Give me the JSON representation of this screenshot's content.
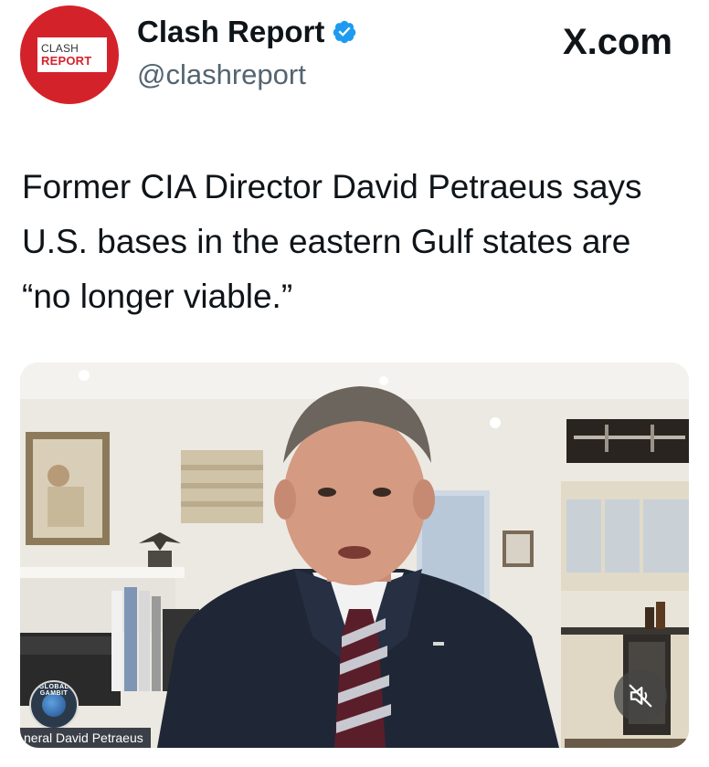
{
  "header": {
    "avatar": {
      "line1": "CLASH",
      "line2": "REPORT",
      "bg_color": "#d4222b"
    },
    "display_name": "Clash Report",
    "verified_icon": "verified-badge-icon",
    "handle": "@clashreport",
    "site": "X.com"
  },
  "tweet": {
    "text": "Former CIA Director David Petraeus says U.S. bases in the eastern Gulf states are “no longer viable.”"
  },
  "video": {
    "logo_text": "GLOBAL GAMBIT",
    "caption": "neral David Petraeus",
    "mute_icon": "speaker-muted-icon"
  },
  "colors": {
    "text": "#0f1419",
    "handle": "#536471",
    "verified": "#1d9bf0",
    "brand_red": "#d4222b"
  }
}
